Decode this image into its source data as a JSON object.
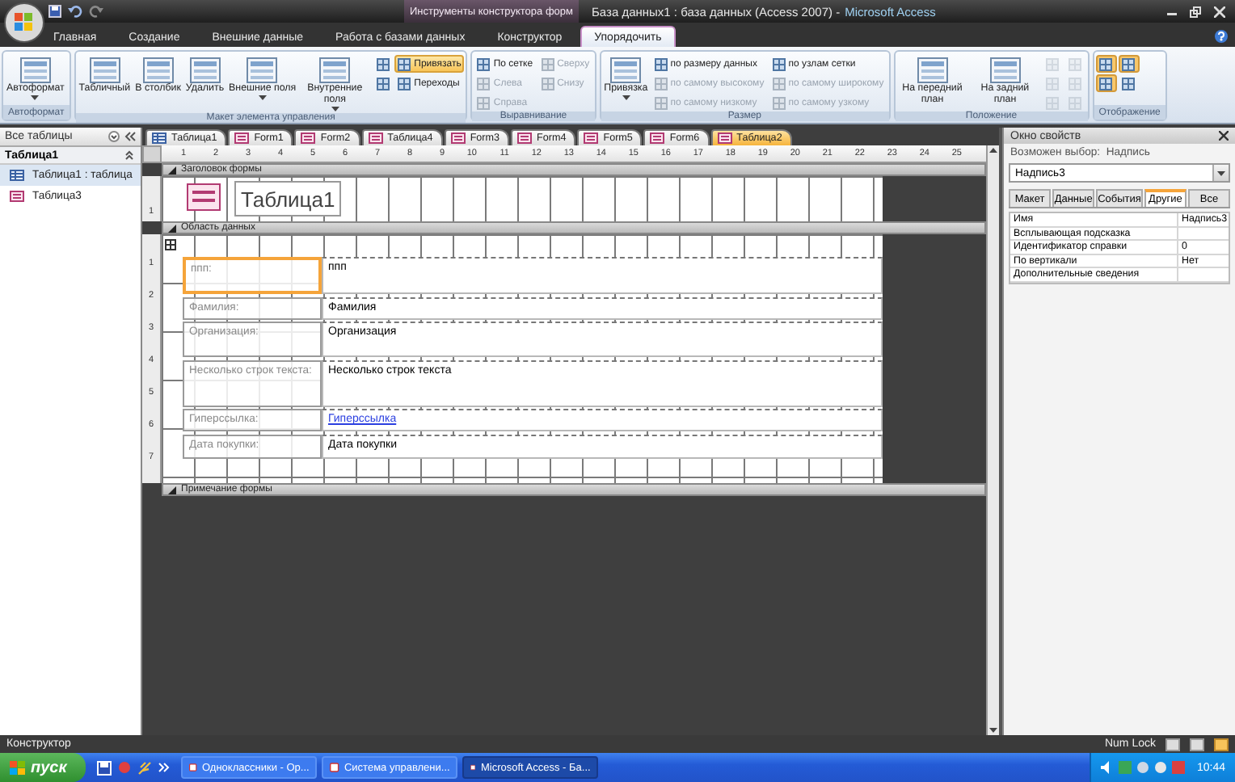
{
  "window": {
    "context_title": "Инструменты конструктора форм",
    "title": "База данных1 : база данных (Access 2007) -",
    "app_name": "Microsoft Access"
  },
  "ribbon": {
    "tabs": [
      {
        "label": "Главная",
        "selected": false
      },
      {
        "label": "Создание",
        "selected": false
      },
      {
        "label": "Внешние данные",
        "selected": false
      },
      {
        "label": "Работа с базами данных",
        "selected": false
      },
      {
        "label": "Конструктор",
        "selected": false
      },
      {
        "label": "Упорядочить",
        "selected": true
      }
    ],
    "groups": [
      {
        "label": "Автоформат",
        "columns": [
          [
            {
              "kind": "large",
              "label": "Автоформат",
              "menu": true,
              "pressed": false,
              "disabled": false
            }
          ]
        ]
      },
      {
        "label": "Макет элемента управления",
        "columns": [
          [
            {
              "kind": "large",
              "label": "Табличный",
              "menu": false,
              "pressed": false,
              "disabled": false
            }
          ],
          [
            {
              "kind": "large",
              "label": "В столбик",
              "menu": false,
              "pressed": false,
              "disabled": false
            }
          ],
          [
            {
              "kind": "large",
              "label": "Удалить",
              "menu": false,
              "pressed": false,
              "disabled": false
            }
          ],
          [
            {
              "kind": "large",
              "label": "Внешние поля",
              "menu": true,
              "pressed": false,
              "disabled": false
            }
          ],
          [
            {
              "kind": "large",
              "label": "Внутренние поля",
              "menu": true,
              "pressed": false,
              "disabled": false
            }
          ],
          [
            {
              "kind": "icon",
              "menu": false,
              "pressed": false,
              "disabled": false
            },
            {
              "kind": "icon",
              "menu": false,
              "pressed": false,
              "disabled": false
            }
          ],
          [
            {
              "kind": "small",
              "label": "Привязать",
              "menu": false,
              "pressed": true,
              "disabled": false
            },
            {
              "kind": "small",
              "label": "Переходы",
              "menu": false,
              "pressed": false,
              "disabled": false
            }
          ]
        ]
      },
      {
        "label": "Выравнивание",
        "columns": [
          [
            {
              "kind": "small",
              "label": "По сетке",
              "menu": false,
              "pressed": false,
              "disabled": false
            },
            {
              "kind": "small",
              "label": "Слева",
              "menu": false,
              "pressed": false,
              "disabled": true
            },
            {
              "kind": "small",
              "label": "Справа",
              "menu": false,
              "pressed": false,
              "disabled": true
            }
          ],
          [
            {
              "kind": "small",
              "label": "Сверху",
              "menu": false,
              "pressed": false,
              "disabled": true
            },
            {
              "kind": "small",
              "label": "Снизу",
              "menu": false,
              "pressed": false,
              "disabled": true
            }
          ]
        ]
      },
      {
        "label": "Размер",
        "columns": [
          [
            {
              "kind": "large",
              "label": "Привязка",
              "menu": true,
              "pressed": false,
              "disabled": false
            }
          ],
          [
            {
              "kind": "small",
              "label": "по размеру данных",
              "menu": false,
              "pressed": false,
              "disabled": false
            },
            {
              "kind": "small",
              "label": "по самому высокому",
              "menu": false,
              "pressed": false,
              "disabled": true
            },
            {
              "kind": "small",
              "label": "по самому низкому",
              "menu": false,
              "pressed": false,
              "disabled": true
            }
          ],
          [
            {
              "kind": "small",
              "label": "по узлам сетки",
              "menu": false,
              "pressed": false,
              "disabled": false
            },
            {
              "kind": "small",
              "label": "по самому широкому",
              "menu": false,
              "pressed": false,
              "disabled": true
            },
            {
              "kind": "small",
              "label": "по самому узкому",
              "menu": false,
              "pressed": false,
              "disabled": true
            }
          ]
        ]
      },
      {
        "label": "Положение",
        "columns": [
          [
            {
              "kind": "large",
              "label": "На передний план",
              "menu": false,
              "pressed": false,
              "disabled": false
            }
          ],
          [
            {
              "kind": "large",
              "label": "На задний план",
              "menu": false,
              "pressed": false,
              "disabled": false
            }
          ],
          [
            {
              "kind": "icon",
              "menu": false,
              "pressed": false,
              "disabled": true
            },
            {
              "kind": "icon",
              "menu": false,
              "pressed": false,
              "disabled": true
            },
            {
              "kind": "icon",
              "menu": false,
              "pressed": false,
              "disabled": true
            }
          ],
          [
            {
              "kind": "icon",
              "menu": false,
              "pressed": false,
              "disabled": true
            },
            {
              "kind": "icon",
              "menu": false,
              "pressed": false,
              "disabled": true
            },
            {
              "kind": "icon",
              "menu": false,
              "pressed": false,
              "disabled": true
            }
          ]
        ]
      },
      {
        "label": "Отображение",
        "columns": [
          [
            {
              "kind": "icon",
              "menu": false,
              "pressed": true,
              "disabled": false
            },
            {
              "kind": "icon",
              "menu": false,
              "pressed": true,
              "disabled": false
            }
          ],
          [
            {
              "kind": "icon",
              "menu": false,
              "pressed": true,
              "disabled": false
            },
            {
              "kind": "icon",
              "menu": false,
              "pressed": false,
              "disabled": false
            }
          ]
        ]
      }
    ]
  },
  "nav": {
    "title": "Все таблицы",
    "groups": [
      {
        "label": "Таблица1",
        "expanded": true,
        "items": [
          {
            "label": "Таблица1 : таблица",
            "kind": "table",
            "selected": true
          },
          {
            "label": "Таблица3",
            "kind": "form",
            "selected": false
          }
        ]
      }
    ]
  },
  "document": {
    "tabs": [
      {
        "label": "Таблица1",
        "kind": "table",
        "selected": false
      },
      {
        "label": "Form1",
        "kind": "form",
        "selected": false
      },
      {
        "label": "Form2",
        "kind": "form",
        "selected": false
      },
      {
        "label": "Таблица4",
        "kind": "form",
        "selected": false
      },
      {
        "label": "Form3",
        "kind": "form",
        "selected": false
      },
      {
        "label": "Form4",
        "kind": "form",
        "selected": false
      },
      {
        "label": "Form5",
        "kind": "form",
        "selected": false
      },
      {
        "label": "Form6",
        "kind": "form",
        "selected": false
      },
      {
        "label": "Таблица2",
        "kind": "form",
        "selected": true
      }
    ],
    "ruler": [
      "1",
      "2",
      "3",
      "4",
      "5",
      "6",
      "7",
      "8",
      "9",
      "10",
      "11",
      "12",
      "13",
      "14",
      "15",
      "16",
      "17",
      "18",
      "19",
      "20",
      "21",
      "22",
      "23",
      "24",
      "25"
    ],
    "sections": [
      {
        "kind": "header",
        "label": "Заголовок формы",
        "ruler": [
          "1"
        ],
        "title": "Таблица1"
      },
      {
        "kind": "detail",
        "label": "Область данных",
        "ruler": [
          "1",
          "2",
          "3",
          "4",
          "5",
          "6",
          "7"
        ],
        "fields": [
          {
            "label": "ппп:",
            "value": "ппп",
            "kind": "text",
            "selected": true
          },
          {
            "label": "Фамилия:",
            "value": "Фамилия",
            "kind": "text",
            "selected": false
          },
          {
            "label": "Организация:",
            "value": "Организация",
            "kind": "text",
            "selected": false
          },
          {
            "label": "Несколько строк текста:",
            "value": "Несколько строк текста",
            "kind": "text",
            "selected": false
          },
          {
            "label": "Гиперссылка:",
            "value": "Гиперссылка",
            "kind": "link",
            "selected": false
          },
          {
            "label": "Дата покупки:",
            "value": "Дата покупки",
            "kind": "text",
            "selected": false
          }
        ]
      },
      {
        "kind": "footer",
        "label": "Примечание формы"
      }
    ]
  },
  "property_sheet": {
    "title": "Окно свойств",
    "selection_type": "Возможен выбор:  Надпись",
    "selected_object": "Надпись3",
    "tabs": [
      {
        "label": "Макет",
        "selected": false
      },
      {
        "label": "Данные",
        "selected": false
      },
      {
        "label": "События",
        "selected": false
      },
      {
        "label": "Другие",
        "selected": true
      },
      {
        "label": "Все",
        "selected": false
      }
    ],
    "rows": [
      {
        "name": "Имя",
        "value": "Надпись3"
      },
      {
        "name": "Всплывающая подсказка"
      },
      {
        "name": "Идентификатор справки",
        "value": "0"
      },
      {
        "name": "По вертикали",
        "value": "Нет"
      },
      {
        "name": "Дополнительные сведения"
      }
    ]
  },
  "status_bar": {
    "mode": "Конструктор",
    "indicator": "Num Lock"
  },
  "taskbar": {
    "start": "пуск",
    "tasks": [
      {
        "label": "Одноклассники - Ор...",
        "selected": false
      },
      {
        "label": "Система управлени...",
        "selected": false
      },
      {
        "label": "Microsoft Access - Ба...",
        "selected": true
      }
    ],
    "clock": "10:44"
  }
}
